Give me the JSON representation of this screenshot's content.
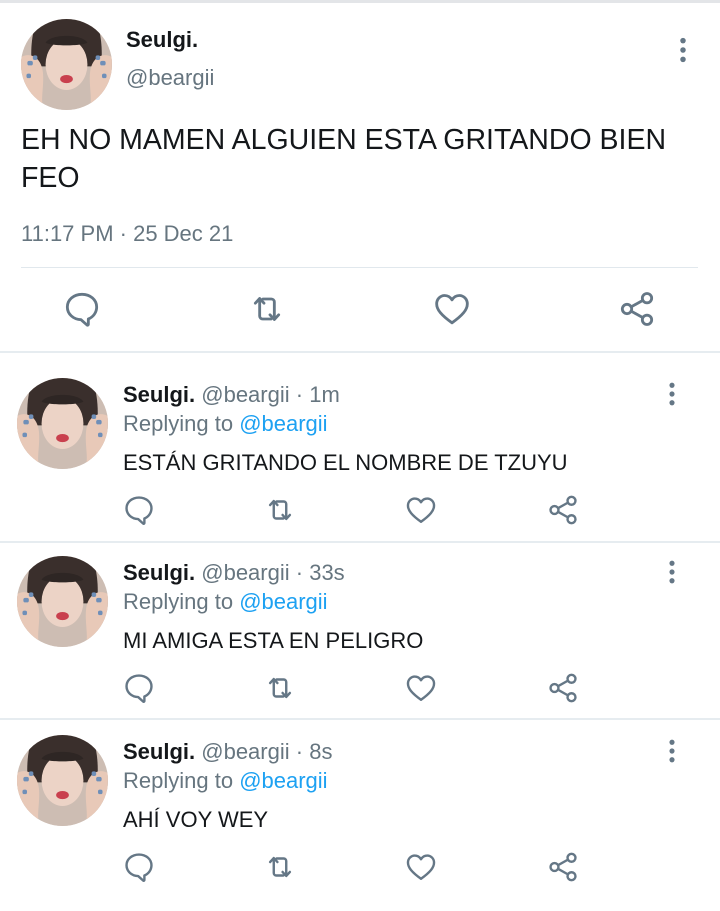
{
  "main_tweet": {
    "author_name": "Seulgi.",
    "author_handle": "@beargii",
    "text": "EH NO MAMEN ALGUIEN ESTA GRITANDO BIEN FEO",
    "timestamp": "11:17 PM · 25 Dec 21"
  },
  "replies": [
    {
      "author_name": "Seulgi.",
      "author_handle": "@beargii",
      "time_ago": "1m",
      "replying_prefix": "Replying to ",
      "replying_to": "@beargii",
      "text": "ESTÁN GRITANDO EL NOMBRE DE TZUYU"
    },
    {
      "author_name": "Seulgi.",
      "author_handle": "@beargii",
      "time_ago": "33s",
      "replying_prefix": "Replying to ",
      "replying_to": "@beargii",
      "text": "MI AMIGA ESTA EN PELIGRO"
    },
    {
      "author_name": "Seulgi.",
      "author_handle": "@beargii",
      "time_ago": "8s",
      "replying_prefix": "Replying to ",
      "replying_to": "@beargii",
      "text": "AHÍ VOY WEY"
    }
  ],
  "colors": {
    "link": "#1da1f2",
    "secondary_text": "#66757f",
    "icon": "#657786"
  },
  "icons": [
    "more-icon",
    "reply-icon",
    "retweet-icon",
    "like-icon",
    "share-icon"
  ]
}
